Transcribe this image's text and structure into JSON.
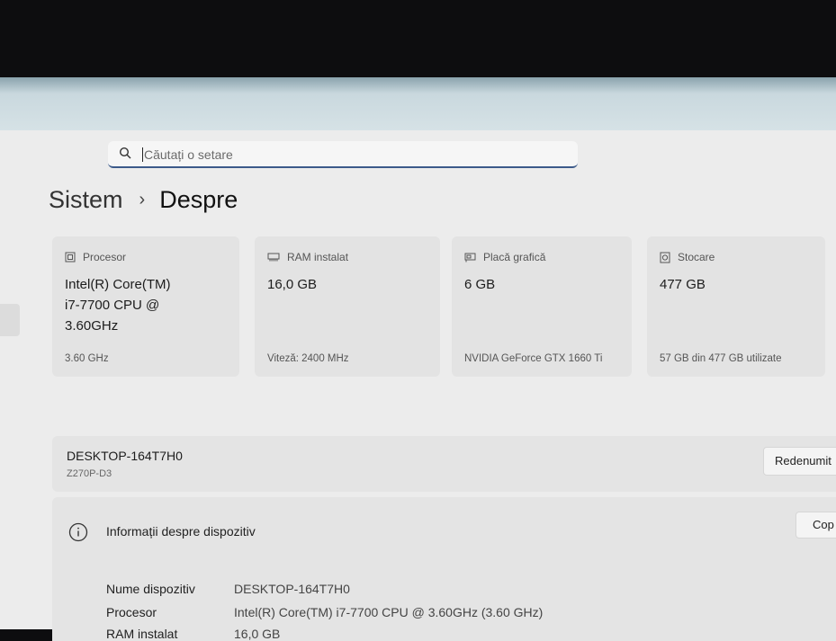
{
  "search": {
    "placeholder": "Căutați o setare"
  },
  "breadcrumb": {
    "parent": "Sistem",
    "separator": "›",
    "current": "Despre"
  },
  "cards": [
    {
      "label": "Procesor",
      "value_lines": [
        "Intel(R) Core(TM)",
        "i7-7700 CPU @",
        "3.60GHz"
      ],
      "sub": "3.60 GHz",
      "icon": "cpu-icon"
    },
    {
      "label": "RAM instalat",
      "value_lines": [
        "16,0 GB"
      ],
      "sub": "Viteză: 2400 MHz",
      "icon": "ram-icon"
    },
    {
      "label": "Placă grafică",
      "value_lines": [
        "6 GB"
      ],
      "sub": "NVIDIA GeForce GTX 1660 Ti",
      "icon": "gpu-icon"
    },
    {
      "label": "Stocare",
      "value_lines": [
        "477 GB"
      ],
      "sub": "57 GB din 477 GB utilizate",
      "icon": "storage-icon"
    }
  ],
  "device": {
    "name": "DESKTOP-164T7H0",
    "model": "Z270P-D3",
    "rename_label": "Redenumit"
  },
  "device_info": {
    "title": "Informații despre dispozitiv",
    "copy_label": "Cop",
    "rows": [
      {
        "key": "Nume dispozitiv",
        "value": "DESKTOP-164T7H0"
      },
      {
        "key": "Procesor",
        "value": "Intel(R) Core(TM) i7-7700 CPU @ 3.60GHz (3.60 GHz)"
      },
      {
        "key": "RAM instalat",
        "value": "16,0 GB"
      }
    ]
  }
}
